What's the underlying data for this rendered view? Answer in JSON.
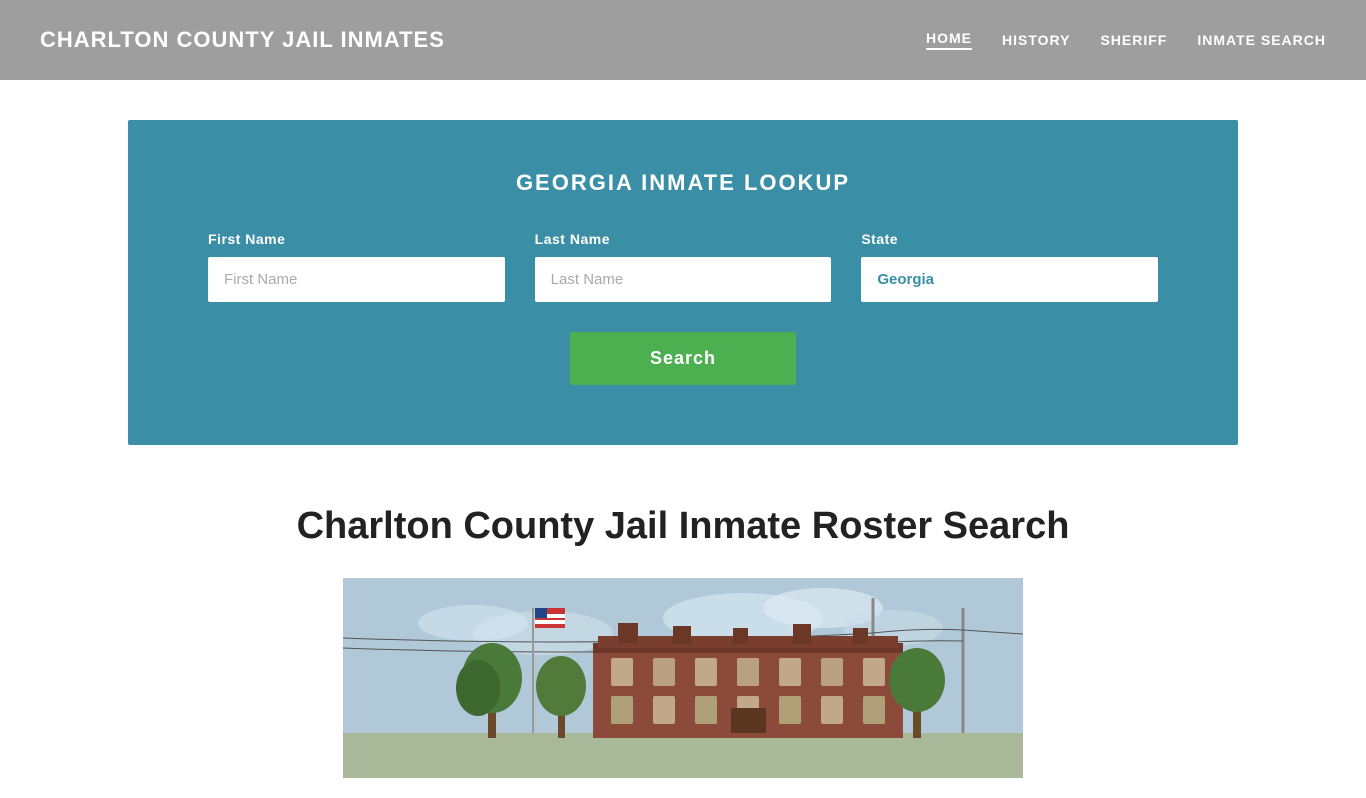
{
  "header": {
    "site_title": "CHARLTON COUNTY JAIL INMATES",
    "nav": [
      {
        "label": "HOME",
        "active": true
      },
      {
        "label": "HISTORY",
        "active": false
      },
      {
        "label": "SHERIFF",
        "active": false
      },
      {
        "label": "INMATE SEARCH",
        "active": false
      }
    ]
  },
  "search_panel": {
    "title": "GEORGIA INMATE LOOKUP",
    "fields": {
      "first_name": {
        "label": "First Name",
        "placeholder": "First Name"
      },
      "last_name": {
        "label": "Last Name",
        "placeholder": "Last Name"
      },
      "state": {
        "label": "State",
        "value": "Georgia"
      }
    },
    "search_button": "Search"
  },
  "main": {
    "roster_title": "Charlton County Jail Inmate Roster Search"
  },
  "colors": {
    "header_bg": "#9e9e9e",
    "search_panel_bg": "#3a8ea5",
    "search_btn_bg": "#4caf50",
    "nav_text": "#ffffff",
    "site_title": "#ffffff"
  }
}
